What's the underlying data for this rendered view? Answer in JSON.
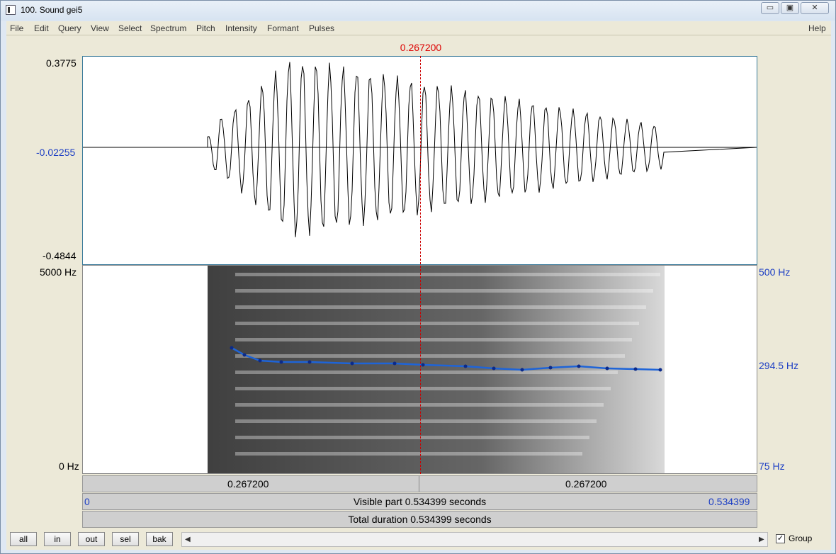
{
  "window": {
    "title": "100. Sound gei5",
    "minimize_glyph": "▭",
    "maximize_glyph": "▣",
    "close_glyph": "✕"
  },
  "menu": [
    "File",
    "Edit",
    "Query",
    "View",
    "Select",
    "Spectrum",
    "Pitch",
    "Intensity",
    "Formant",
    "Pulses"
  ],
  "help_label": "Help",
  "cursor_time": "0.267200",
  "waveform": {
    "ymax": "0.3775",
    "ymid": "-0.02255",
    "ymin": "-0.4844"
  },
  "spectrogram": {
    "fmax": "5000 Hz",
    "fmin": "0 Hz",
    "pitch_max": "500 Hz",
    "pitch_mid": "294.5 Hz",
    "pitch_min": "75 Hz"
  },
  "time_bar": {
    "left_time": "0.267200",
    "right_time": "0.267200"
  },
  "visible_bar": {
    "start": "0",
    "text": "Visible part 0.534399 seconds",
    "end": "0.534399"
  },
  "total_bar": {
    "text": "Total duration 0.534399 seconds"
  },
  "buttons": {
    "all": "all",
    "in": "in",
    "out": "out",
    "sel": "sel",
    "bak": "bak"
  },
  "scroll": {
    "left_arrow": "◀",
    "right_arrow": "▶"
  },
  "group": {
    "checked": "✓",
    "label": "Group"
  },
  "colors": {
    "cursor": "#d00000",
    "pitch_line": "#1e64d8",
    "axis_blue": "#1d3fc4"
  }
}
